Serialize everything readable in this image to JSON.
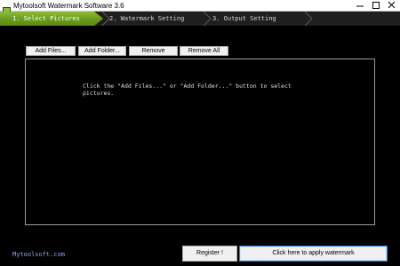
{
  "window": {
    "title": "Mytoolsoft Watermark Software 3.6"
  },
  "steps": [
    {
      "label": "1. Select Pictures",
      "active": true
    },
    {
      "label": "2. Watermark Setting",
      "active": false
    },
    {
      "label": "3. Output Setting",
      "active": false
    }
  ],
  "toolbar": {
    "add_files": "Add Files...",
    "add_folder": "Add Folder...",
    "remove": "Remove",
    "remove_all": "Remove All"
  },
  "picture_list": {
    "hint": "Click the \"Add Files...\" or \"Add Folder...\" button to select pictures."
  },
  "footer": {
    "site_link": "Mytoolsoft.com",
    "register": "Register !",
    "apply": "Click here to apply watermark"
  },
  "colors": {
    "active_step": "#7aab26",
    "link": "#8ea2ff",
    "background": "#000000"
  }
}
